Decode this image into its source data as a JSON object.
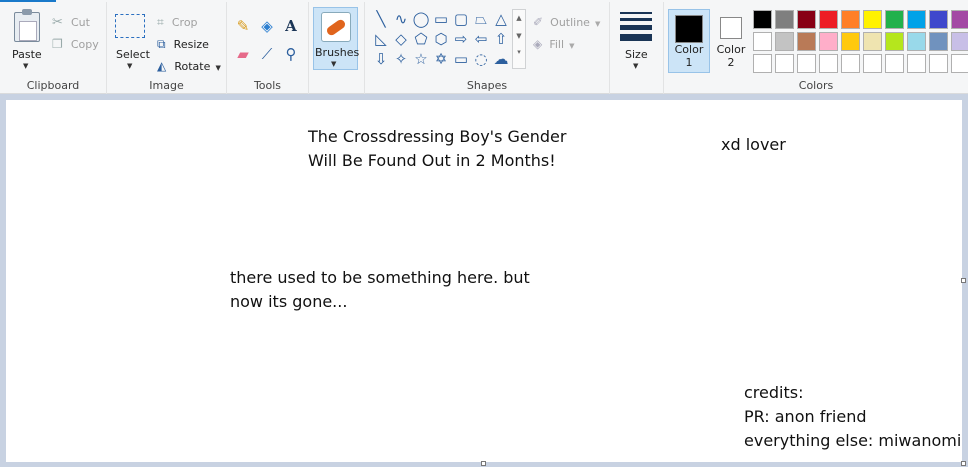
{
  "ribbon": {
    "clipboard": {
      "group_label": "Clipboard",
      "paste": "Paste",
      "cut": "Cut",
      "copy": "Copy"
    },
    "image": {
      "group_label": "Image",
      "select": "Select",
      "crop": "Crop",
      "resize": "Resize",
      "rotate": "Rotate"
    },
    "tools": {
      "group_label": "Tools",
      "text_glyph": "A"
    },
    "brushes": {
      "label": "Brushes"
    },
    "shapes": {
      "group_label": "Shapes",
      "outline": "Outline",
      "fill": "Fill"
    },
    "size": {
      "label": "Size"
    },
    "colors": {
      "group_label": "Colors",
      "color1": {
        "label_line1": "Color",
        "label_line2": "1",
        "value": "#000000"
      },
      "color2": {
        "label_line1": "Color",
        "label_line2": "2",
        "value": "#ffffff"
      },
      "palette_row1": [
        "#000000",
        "#7f7f7f",
        "#880015",
        "#ed1c24",
        "#ff7f27",
        "#fff200",
        "#22b14c",
        "#00a2e8",
        "#3f48cc",
        "#a349a4"
      ],
      "palette_row2": [
        "#ffffff",
        "#c3c3c3",
        "#b97a57",
        "#ffaec9",
        "#ffc90e",
        "#efe4b0",
        "#b5e61d",
        "#99d9ea",
        "#7092be",
        "#c8bfe7"
      ],
      "palette_row3": [
        "#ffffff",
        "#ffffff",
        "#ffffff",
        "#ffffff",
        "#ffffff",
        "#ffffff",
        "#ffffff",
        "#ffffff",
        "#ffffff",
        "#ffffff"
      ]
    }
  },
  "canvas": {
    "title_line1": "The Crossdressing Boy's Gender",
    "title_line2": "Will Be Found Out in 2 Months!",
    "tag": "xd lover",
    "note_line1": "there used to be something here. but",
    "note_line2": "now its gone...",
    "credits_line1": "credits:",
    "credits_line2": "PR: anon friend",
    "credits_line3": "everything else: miwanomi"
  }
}
